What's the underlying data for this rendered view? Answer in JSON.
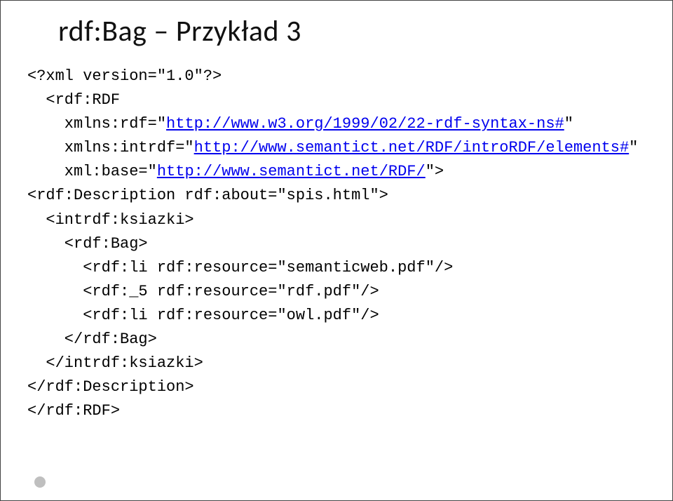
{
  "title": "rdf:Bag – Przykład 3",
  "code": {
    "l01": "<?xml version=\"1.0\"?>",
    "l02": "  <rdf:RDF",
    "l03a": "    xmlns:rdf=\"",
    "l03link": "http://www.w3.org/1999/02/22-rdf-syntax-ns#",
    "l03b": "\"",
    "l04a": "    xmlns:intrdf=\"",
    "l04link": "http://www.semantict.net/RDF/introRDF/elements#",
    "l04b": "\"",
    "l05a": "    xml:base=\"",
    "l05link": "http://www.semantict.net/RDF/",
    "l05b": "\">",
    "l06": "<rdf:Description rdf:about=\"spis.html\">",
    "l07": "  <intrdf:ksiazki>",
    "l08": "    <rdf:Bag>",
    "l09": "      <rdf:li rdf:resource=\"semanticweb.pdf\"/>",
    "l10": "      <rdf:_5 rdf:resource=\"rdf.pdf\"/>",
    "l11": "      <rdf:li rdf:resource=\"owl.pdf\"/>",
    "l12": "    </rdf:Bag>",
    "l13": "  </intrdf:ksiazki>",
    "l14": "</rdf:Description>",
    "l15": "</rdf:RDF>"
  }
}
